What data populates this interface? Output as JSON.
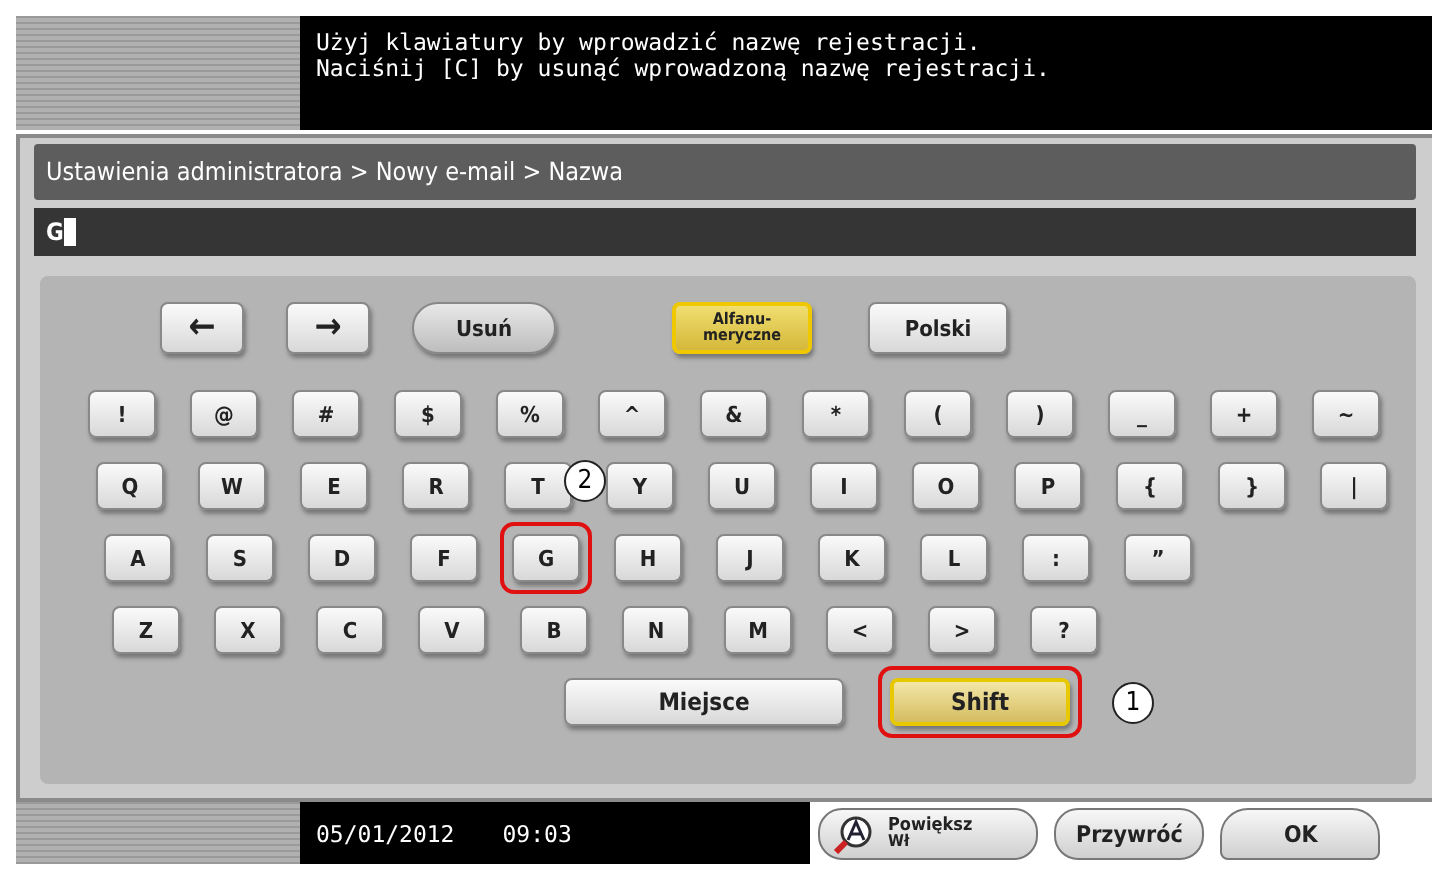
{
  "message": [
    "Użyj klawiatury by wprowadzić nazwę rejestracji.",
    "Naciśnij [C] by usunąć wprowadzoną nazwę rejestracji."
  ],
  "breadcrumb": "Ustawienia administratora > Nowy e-mail > Nazwa",
  "input": {
    "value": "G"
  },
  "top_keys": [
    {
      "kind": "arrow",
      "label": "←"
    },
    {
      "kind": "arrow",
      "label": "→"
    },
    {
      "kind": "pill",
      "label": "Usuń"
    },
    {
      "kind": "mode",
      "label": "Alfanu-\nmeryczne",
      "selected": true
    },
    {
      "kind": "mode",
      "label": "Polski",
      "selected": false
    }
  ],
  "key_rows": [
    [
      {
        "label": "!"
      },
      {
        "label": "@"
      },
      {
        "label": "#"
      },
      {
        "label": "$"
      },
      {
        "label": "%"
      },
      {
        "label": "^"
      },
      {
        "label": "&"
      },
      {
        "label": "*"
      },
      {
        "label": "("
      },
      {
        "label": ")"
      },
      {
        "label": "_"
      },
      {
        "label": "+"
      },
      {
        "label": "~"
      }
    ],
    [
      {
        "label": "Q"
      },
      {
        "label": "W"
      },
      {
        "label": "E"
      },
      {
        "label": "R"
      },
      {
        "label": "T"
      },
      {
        "label": "Y"
      },
      {
        "label": "U"
      },
      {
        "label": "I"
      },
      {
        "label": "O"
      },
      {
        "label": "P"
      },
      {
        "label": "{"
      },
      {
        "label": "}"
      },
      {
        "label": "|"
      }
    ],
    [
      {
        "label": "A"
      },
      {
        "label": "S"
      },
      {
        "label": "D"
      },
      {
        "label": "F"
      },
      {
        "label": "G",
        "highlighted": true,
        "callout": "2"
      },
      {
        "label": "H"
      },
      {
        "label": "J"
      },
      {
        "label": "K"
      },
      {
        "label": "L"
      },
      {
        "label": ":"
      },
      {
        "label": "”"
      }
    ],
    [
      {
        "label": "Z"
      },
      {
        "label": "X"
      },
      {
        "label": "C"
      },
      {
        "label": "V"
      },
      {
        "label": "B"
      },
      {
        "label": "N"
      },
      {
        "label": "M"
      },
      {
        "label": "<"
      },
      {
        "label": ">"
      },
      {
        "label": "?"
      }
    ]
  ],
  "space_key": {
    "label": "Miejsce"
  },
  "shift_key": {
    "label": "Shift",
    "selected": true,
    "highlighted": true,
    "callout": "1"
  },
  "footer": {
    "date": "05/01/2012",
    "time": "09:03",
    "buttons": [
      {
        "kind": "zoom",
        "label": "Powiększ",
        "sublabel": "Wł"
      },
      {
        "kind": "plain",
        "label": "Przywróć"
      },
      {
        "kind": "plain",
        "label": "OK"
      }
    ]
  }
}
